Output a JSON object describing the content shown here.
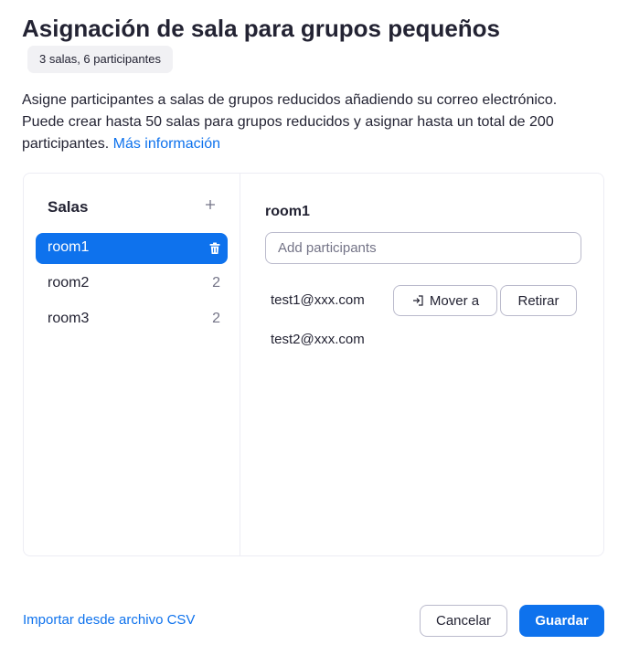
{
  "dialog": {
    "title": "Asignación de sala para grupos pequeños",
    "summary_badge": "3 salas, 6 participantes",
    "description_line1": "Asigne participantes a salas de grupos reducidos añadiendo su correo electrónico.",
    "description_line2": "Puede crear hasta 50 salas para grupos reducidos y asignar hasta un total de 200",
    "description_line3": "participantes.",
    "more_info_link": "Más información"
  },
  "sidebar": {
    "title": "Salas",
    "add_icon": "plus-icon",
    "rooms": [
      {
        "name": "room1",
        "count": "",
        "selected": true,
        "icon": "trash-icon"
      },
      {
        "name": "room2",
        "count": "2",
        "selected": false
      },
      {
        "name": "room3",
        "count": "2",
        "selected": false
      }
    ]
  },
  "detail": {
    "room_title": "room1",
    "add_placeholder": "Add participants",
    "participants": [
      {
        "email": "test1@xxx.com",
        "move_label": "Mover a",
        "move_icon": "move-to-icon",
        "remove_label": "Retirar"
      },
      {
        "email": "test2@xxx.com"
      }
    ]
  },
  "footer": {
    "import_link": "Importar desde archivo CSV",
    "cancel_label": "Cancelar",
    "save_label": "Guardar"
  },
  "colors": {
    "accent": "#0e72ed",
    "text": "#232333",
    "muted": "#747487",
    "border": "#babacc",
    "panel_border": "#ededf4",
    "badge_bg": "#f1f1f4"
  }
}
